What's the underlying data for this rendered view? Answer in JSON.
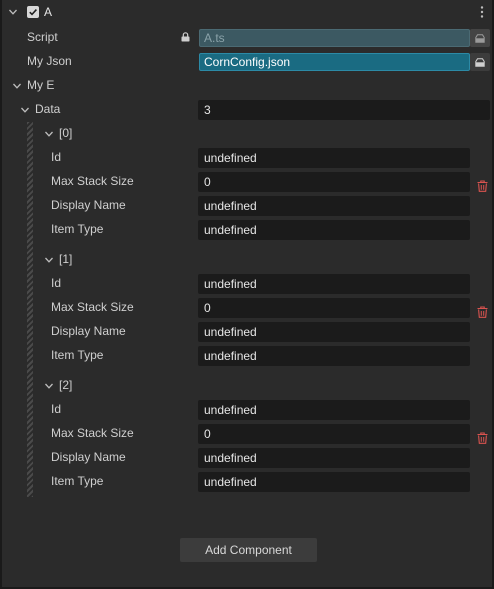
{
  "component": {
    "name": "A",
    "enabled": true,
    "icons": {
      "collapse": "chevron-down-icon",
      "menu": "vertical-dots-icon",
      "enabled": "checkmark-icon"
    }
  },
  "props": {
    "script": {
      "label": "Script",
      "value": "A.ts",
      "locked": true
    },
    "my_json": {
      "label": "My Json",
      "value": "CornConfig.json"
    },
    "my_e": {
      "label": "My E"
    },
    "data": {
      "label": "Data",
      "count": "3"
    }
  },
  "items": [
    {
      "header": "[0]",
      "fields": [
        {
          "label": "Id",
          "value": "undefined"
        },
        {
          "label": "Max Stack Size",
          "value": "0"
        },
        {
          "label": "Display Name",
          "value": "undefined"
        },
        {
          "label": "Item Type",
          "value": "undefined"
        }
      ]
    },
    {
      "header": "[1]",
      "fields": [
        {
          "label": "Id",
          "value": "undefined"
        },
        {
          "label": "Max Stack Size",
          "value": "0"
        },
        {
          "label": "Display Name",
          "value": "undefined"
        },
        {
          "label": "Item Type",
          "value": "undefined"
        }
      ]
    },
    {
      "header": "[2]",
      "fields": [
        {
          "label": "Id",
          "value": "undefined"
        },
        {
          "label": "Max Stack Size",
          "value": "0"
        },
        {
          "label": "Display Name",
          "value": "undefined"
        },
        {
          "label": "Item Type",
          "value": "undefined"
        }
      ]
    }
  ],
  "footer": {
    "add_component_label": "Add Component"
  },
  "colors": {
    "accent": "#1a6b82",
    "delete": "#d9534f",
    "field_bg": "#1b1b1b",
    "panel_bg": "#2b2b2b"
  }
}
